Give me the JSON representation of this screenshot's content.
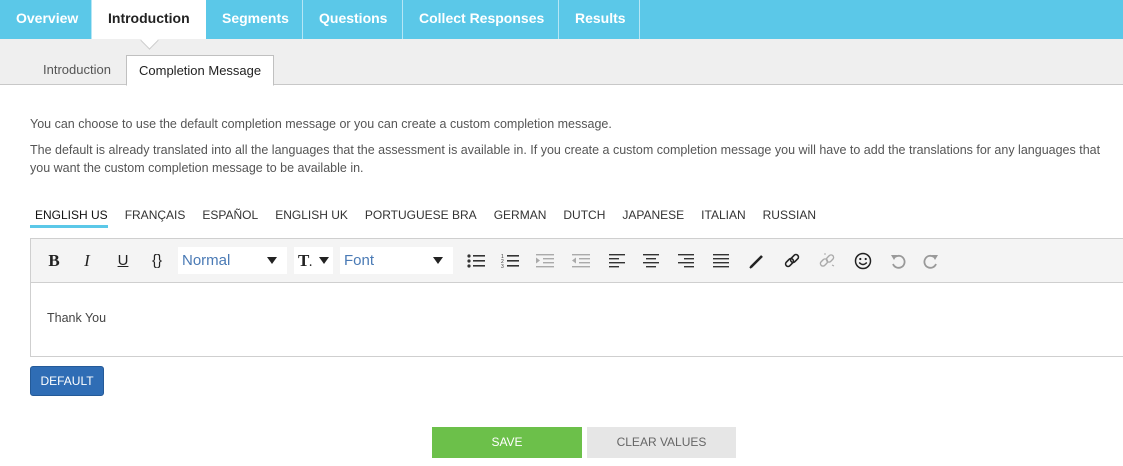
{
  "top_nav": {
    "tabs": [
      "Overview",
      "Introduction",
      "Segments",
      "Questions",
      "Collect Responses",
      "Results"
    ],
    "active": "Introduction"
  },
  "sub_tabs": {
    "introduction": "Introduction",
    "completion_message": "Completion Message",
    "active": "Completion Message"
  },
  "description": {
    "line1": "You can choose to use the default completion message or you can create a custom completion message.",
    "line2": "The default is already translated into all the languages that the assessment is available in. If you create a custom completion message you will have to add the translations for any languages that you want the custom completion message to be available in."
  },
  "languages": {
    "items": [
      "ENGLISH US",
      "FRANÇAIS",
      "ESPAÑOL",
      "ENGLISH UK",
      "PORTUGUESE BRA",
      "GERMAN",
      "DUTCH",
      "JAPANESE",
      "ITALIAN",
      "RUSSIAN"
    ],
    "active": "ENGLISH US"
  },
  "editor": {
    "toolbar": {
      "bold": "B",
      "italic": "I",
      "underline": "U",
      "code": "{}",
      "paragraph_format": "Normal",
      "font_family": "Font"
    },
    "content": "Thank You"
  },
  "buttons": {
    "default": "DEFAULT",
    "save": "SAVE",
    "clear": "CLEAR VALUES"
  },
  "colors": {
    "accent": "#5bc8e8",
    "primary_button": "#2f6db5",
    "save_button": "#6cc04a",
    "select_text": "#4a7ab5"
  }
}
